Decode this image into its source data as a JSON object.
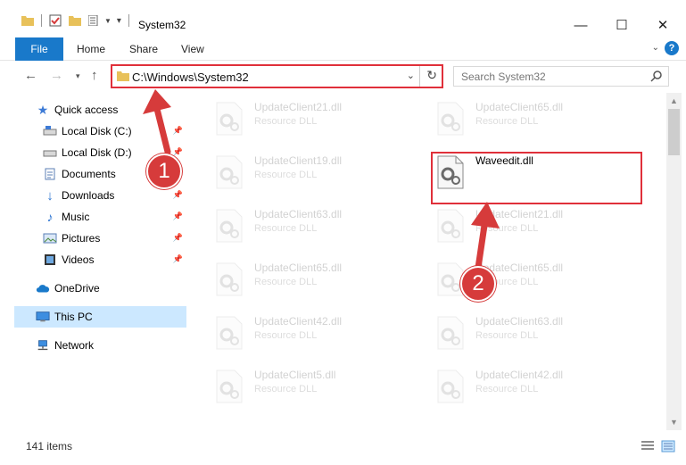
{
  "window": {
    "title": "System32",
    "minimize_glyph": "—",
    "maximize_glyph": "☐",
    "close_glyph": "✕"
  },
  "ribbon": {
    "tabs": [
      "File",
      "Home",
      "Share",
      "View"
    ]
  },
  "address": {
    "path": "C:\\Windows\\System32",
    "search_placeholder": "Search System32"
  },
  "sidebar": {
    "items": [
      {
        "label": "Quick access",
        "icon": "star-icon"
      },
      {
        "label": "Local Disk (C:)",
        "icon": "drive-icon",
        "pinned": true
      },
      {
        "label": "Local Disk (D:)",
        "icon": "drive-icon",
        "pinned": true
      },
      {
        "label": "Documents",
        "icon": "document-icon",
        "pinned": true
      },
      {
        "label": "Downloads",
        "icon": "download-icon",
        "pinned": true
      },
      {
        "label": "Music",
        "icon": "music-icon",
        "pinned": true
      },
      {
        "label": "Pictures",
        "icon": "pictures-icon",
        "pinned": true
      },
      {
        "label": "Videos",
        "icon": "video-icon",
        "pinned": true
      },
      {
        "label": "OneDrive",
        "icon": "cloud-icon"
      },
      {
        "label": "This PC",
        "icon": "computer-icon",
        "selected": true
      },
      {
        "label": "Network",
        "icon": "network-icon"
      }
    ]
  },
  "files": {
    "left_column": [
      {
        "name": "UpdateClient21.dll",
        "type": "Resource DLL"
      },
      {
        "name": "UpdateClient19.dll",
        "type": "Resource DLL"
      },
      {
        "name": "UpdateClient63.dll",
        "type": "Resource DLL"
      },
      {
        "name": "UpdateClient65.dll",
        "type": "Resource DLL"
      },
      {
        "name": "UpdateClient42.dll",
        "type": "Resource DLL"
      },
      {
        "name": "UpdateClient5.dll",
        "type": "Resource DLL"
      }
    ],
    "right_column": [
      {
        "name": "UpdateClient65.dll",
        "type": "Resource DLL"
      },
      {
        "name": "Waveedit.dll",
        "type": "",
        "highlighted": true
      },
      {
        "name": "UpdateClient21.dll",
        "type": "Resource DLL"
      },
      {
        "name": "UpdateClient65.dll",
        "type": "Resource DLL"
      },
      {
        "name": "UpdateClient63.dll",
        "type": "Resource DLL"
      },
      {
        "name": "UpdateClient42.dll",
        "type": "Resource DLL"
      }
    ]
  },
  "status": {
    "item_count": "141 items"
  },
  "callouts": {
    "step1": "1",
    "step2": "2"
  },
  "colors": {
    "accent": "#1979ca",
    "annotation_red": "#e0303a",
    "selection": "#cce8ff"
  }
}
